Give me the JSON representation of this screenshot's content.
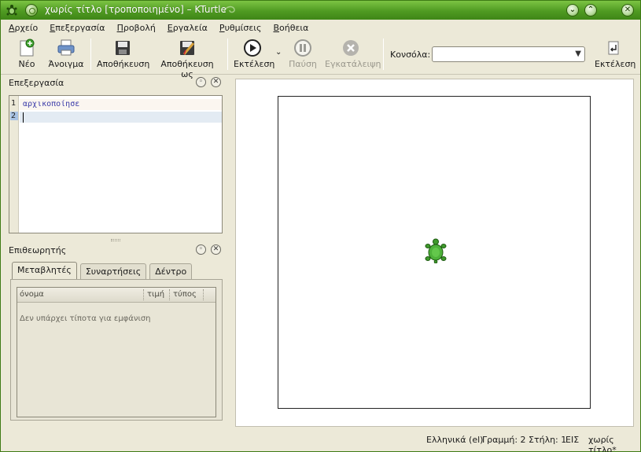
{
  "window": {
    "title": "χωρίς τίτλο [τροποποιημένο] – KTurtle"
  },
  "menubar": [
    "Αρχείο",
    "Επεξεργασία",
    "Προβολή",
    "Εργαλεία",
    "Ρυθμίσεις",
    "Βοήθεια"
  ],
  "toolbar": {
    "new": "Νέο",
    "open": "Άνοιγμα",
    "save": "Αποθήκευση",
    "save_as": "Αποθήκευση ως",
    "run": "Εκτέλεση",
    "pause": "Παύση",
    "abort": "Εγκατάλειψη",
    "console_label": "Κονσόλα:",
    "console_value": "",
    "console_run": "Εκτέλεση"
  },
  "editor": {
    "title": "Επεξεργασία",
    "lines": [
      {
        "number": "1",
        "text": "αρχικοποίησε"
      },
      {
        "number": "2",
        "text": ""
      }
    ]
  },
  "inspector": {
    "title": "Επιθεωρητής",
    "tabs": [
      "Μεταβλητές",
      "Συναρτήσεις",
      "Δέντρο"
    ],
    "columns": [
      "όνομα",
      "τιμή",
      "τύπος"
    ],
    "empty_message": "Δεν υπάρχει τίποτα για εμφάνιση"
  },
  "statusbar": {
    "language": "Ελληνικά (el)",
    "position": "Γραμμή: 2 Στήλη: 1",
    "mode": "ΕΙΣ",
    "file": "χωρίς τίτλο*"
  },
  "colors": {
    "titlebar": "#4f9a22",
    "turtle": "#3f9a2c",
    "keyword": "#3a3aa8"
  }
}
